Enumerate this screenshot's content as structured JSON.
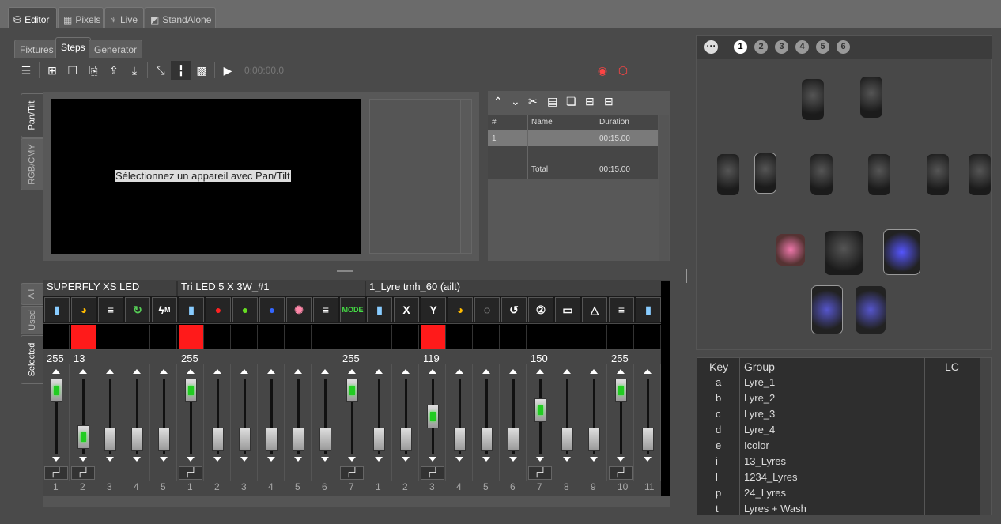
{
  "main_tabs": [
    "Editor",
    "Pixels",
    "Live",
    "StandAlone"
  ],
  "sub_tabs": [
    "Fixtures",
    "Steps",
    "Generator"
  ],
  "toolbar": {
    "time": "0:00:00.0"
  },
  "vtabs_top": [
    "Pan/Tilt",
    "RGB/CMY"
  ],
  "vtabs_bottom": [
    "All",
    "Used",
    "Selected"
  ],
  "pan_msg": "Sélectionnez un appareil avec Pan/Tilt",
  "steps": {
    "headers": [
      "#",
      "Name",
      "Duration"
    ],
    "row": {
      "num": "1",
      "name": "",
      "duration": "00:15.00"
    },
    "total_label": "Total",
    "total": "00:15.00"
  },
  "fixtures": [
    {
      "name": "SUPERFLY XS LED"
    },
    {
      "name": "Tri LED 5 X 3W_#1"
    },
    {
      "name": "1_Lyre tmh_60 (ailt)"
    }
  ],
  "icons_mode_label": "MODE",
  "icons_m_label": "M",
  "channels": [
    {
      "n": "1",
      "v": "255",
      "pos": 0.0,
      "on": true,
      "step": true
    },
    {
      "n": "2",
      "v": "13",
      "pos": 0.95,
      "on": true,
      "step": true
    },
    {
      "n": "3",
      "v": "",
      "pos": 1,
      "on": false,
      "step": false
    },
    {
      "n": "4",
      "v": "",
      "pos": 1,
      "on": false,
      "step": false
    },
    {
      "n": "5",
      "v": "",
      "pos": 1,
      "on": false,
      "step": false
    },
    {
      "n": "1",
      "v": "255",
      "pos": 0.0,
      "on": true,
      "step": true
    },
    {
      "n": "2",
      "v": "",
      "pos": 1,
      "on": false,
      "step": false
    },
    {
      "n": "3",
      "v": "",
      "pos": 1,
      "on": false,
      "step": false
    },
    {
      "n": "4",
      "v": "",
      "pos": 1,
      "on": false,
      "step": false
    },
    {
      "n": "5",
      "v": "",
      "pos": 1,
      "on": false,
      "step": false
    },
    {
      "n": "6",
      "v": "",
      "pos": 1,
      "on": false,
      "step": false
    },
    {
      "n": "7",
      "v": "255",
      "pos": 0.0,
      "on": true,
      "step": true
    },
    {
      "n": "1",
      "v": "",
      "pos": 1,
      "on": false,
      "step": false
    },
    {
      "n": "2",
      "v": "",
      "pos": 1,
      "on": false,
      "step": false
    },
    {
      "n": "3",
      "v": "119",
      "pos": 0.53,
      "on": true,
      "step": true
    },
    {
      "n": "4",
      "v": "",
      "pos": 1,
      "on": false,
      "step": false
    },
    {
      "n": "5",
      "v": "",
      "pos": 1,
      "on": false,
      "step": false
    },
    {
      "n": "6",
      "v": "",
      "pos": 1,
      "on": false,
      "step": false
    },
    {
      "n": "7",
      "v": "150",
      "pos": 0.41,
      "on": true,
      "step": true
    },
    {
      "n": "8",
      "v": "",
      "pos": 1,
      "on": false,
      "step": false
    },
    {
      "n": "9",
      "v": "",
      "pos": 1,
      "on": false,
      "step": false
    },
    {
      "n": "10",
      "v": "255",
      "pos": 0.0,
      "on": true,
      "step": true
    },
    {
      "n": "11",
      "v": "",
      "pos": 1,
      "on": false,
      "step": false
    }
  ],
  "colors": {
    "red": "#ff1a1a",
    "accent": "#2c2"
  },
  "pages": [
    "1",
    "2",
    "3",
    "4",
    "5",
    "6"
  ],
  "key_table": {
    "headers": [
      "Key",
      "Group",
      "LC"
    ],
    "rows": [
      [
        "a",
        "Lyre_1"
      ],
      [
        "b",
        "Lyre_2"
      ],
      [
        "c",
        "Lyre_3"
      ],
      [
        "d",
        "Lyre_4"
      ],
      [
        "e",
        "Icolor"
      ],
      [
        "i",
        "13_Lyres"
      ],
      [
        "l",
        "1234_Lyres"
      ],
      [
        "p",
        "24_Lyres"
      ],
      [
        "t",
        "Lyres + Wash"
      ]
    ]
  }
}
